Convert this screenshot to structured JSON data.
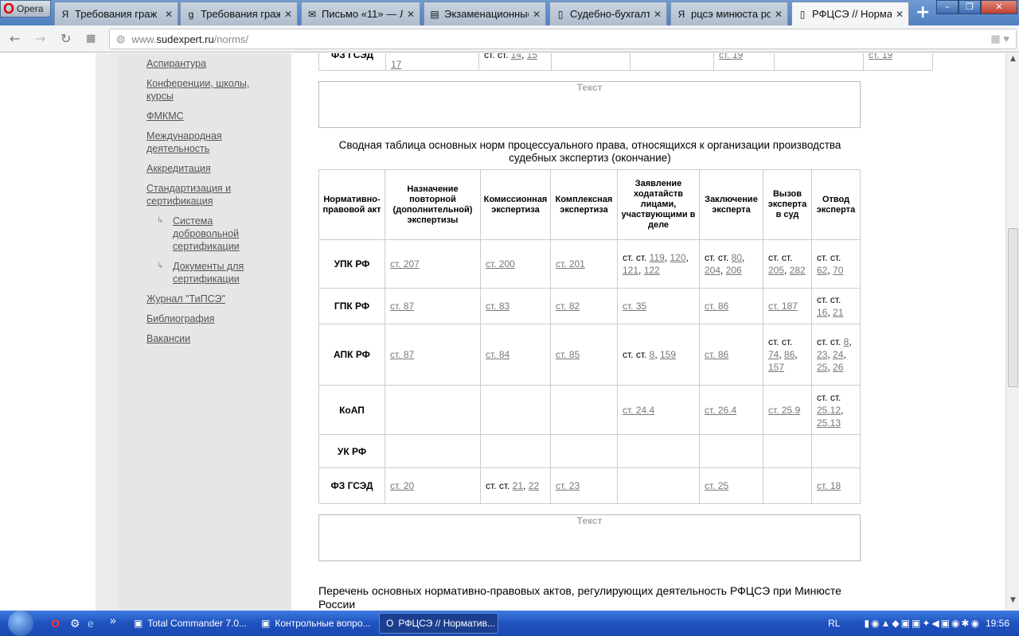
{
  "browser": {
    "menu_label": "Opera",
    "tabs": [
      {
        "title": "Требования граж",
        "icon": "yandex-icon"
      },
      {
        "title": "Требования граж",
        "icon": "google-icon"
      },
      {
        "title": "Письмо «11» — Л",
        "icon": "mail-icon"
      },
      {
        "title": "Экзаменационные",
        "icon": "document-icon"
      },
      {
        "title": "Судебно-бухгалте",
        "icon": "page-icon"
      },
      {
        "title": "рцсэ минюста рос",
        "icon": "yandex-icon"
      },
      {
        "title": "РФЦСЭ // Нормат",
        "icon": "page-icon",
        "active": true
      }
    ],
    "address_prefix": "www.",
    "address_domain": "sudexpert.ru",
    "address_path": "/norms/"
  },
  "sidebar": {
    "items": [
      {
        "label": "Аспирантура"
      },
      {
        "label": "Конференции, школы, курсы"
      },
      {
        "label": "ФМКМС"
      },
      {
        "label": "Международная деятельность"
      },
      {
        "label": "Аккредитация"
      },
      {
        "label": "Стандартизация и сертификация"
      },
      {
        "label": "Система добровольной сертификации",
        "sub": true
      },
      {
        "label": "Документы для сертификации",
        "sub": true
      },
      {
        "label": "Журнал \"ТиПСЭ\""
      },
      {
        "label": "Библиография"
      },
      {
        "label": "Вакансии"
      }
    ]
  },
  "top_row": {
    "act": "ФЗ ГСЭД",
    "c1": "17",
    "c2_prefix": "ст. ст. ",
    "c2_links": [
      "14",
      "15"
    ],
    "c5": "ст. 19",
    "c7": "ст. 19"
  },
  "text_placeholder": "Текст",
  "table": {
    "caption": "Сводная таблица основных норм процессуального права, относящихся к организации производства судебных экспертиз (окончание)",
    "headers": [
      "Нормативно-правовой акт",
      "Назначение повторной (дополнительной) экспертизы",
      "Комиссионная экспертиза",
      "Комплексная экспертиза",
      "Заявление ходатайств лицами, участвующими в деле",
      "Заключение эксперта",
      "Вызов эксперта в суд",
      "Отвод эксперта"
    ],
    "rows": [
      {
        "act": "УПК РФ",
        "cells": [
          {
            "links": [
              "ст. 207"
            ]
          },
          {
            "links": [
              "ст. 200"
            ]
          },
          {
            "links": [
              "ст. 201"
            ]
          },
          {
            "prefix": "ст. ст. ",
            "links": [
              "119",
              "120",
              "121",
              "122"
            ]
          },
          {
            "prefix": "ст. ст. ",
            "links": [
              "80",
              "204",
              "206"
            ]
          },
          {
            "prefix": "ст. ст. ",
            "links": [
              "205",
              "282"
            ]
          },
          {
            "prefix": "ст. ст. ",
            "links": [
              "62",
              "70"
            ]
          }
        ]
      },
      {
        "act": "ГПК РФ",
        "cells": [
          {
            "links": [
              "ст. 87"
            ]
          },
          {
            "links": [
              "ст. 83"
            ]
          },
          {
            "links": [
              "ст. 82"
            ]
          },
          {
            "links": [
              "ст. 35"
            ]
          },
          {
            "links": [
              "ст. 86"
            ]
          },
          {
            "links": [
              "ст. 187"
            ]
          },
          {
            "prefix": "ст. ст. ",
            "links": [
              "16",
              "21"
            ]
          }
        ]
      },
      {
        "act": "АПК РФ",
        "cells": [
          {
            "links": [
              "ст. 87"
            ]
          },
          {
            "links": [
              "ст. 84"
            ]
          },
          {
            "links": [
              "ст. 85"
            ]
          },
          {
            "prefix": "ст. ст. ",
            "links": [
              "8",
              "159"
            ]
          },
          {
            "links": [
              "ст. 86"
            ]
          },
          {
            "prefix": "ст. ст. ",
            "links": [
              "74",
              "86",
              "157"
            ]
          },
          {
            "prefix": "ст. ст. ",
            "links": [
              "8",
              "23",
              "24",
              "25",
              "26"
            ]
          }
        ]
      },
      {
        "act": "КоАП",
        "cells": [
          {},
          {},
          {},
          {
            "links": [
              "ст. 24.4"
            ]
          },
          {
            "links": [
              "ст. 26.4"
            ]
          },
          {
            "links": [
              "ст. 25.9"
            ]
          },
          {
            "prefix": "ст. ст. ",
            "links": [
              "25.12",
              "25.13"
            ]
          }
        ]
      },
      {
        "act": "УК РФ",
        "cells": [
          {},
          {},
          {},
          {},
          {},
          {},
          {}
        ]
      },
      {
        "act": "ФЗ ГСЭД",
        "cells": [
          {
            "links": [
              "ст. 20"
            ]
          },
          {
            "prefix": "ст. ст. ",
            "links": [
              "21",
              "22"
            ]
          },
          {
            "links": [
              "ст. 23"
            ]
          },
          {},
          {
            "links": [
              "ст. 25"
            ]
          },
          {},
          {
            "links": [
              "ст. 18"
            ]
          }
        ]
      }
    ]
  },
  "next_section_title": "Перечень основных нормативно-правовых актов, регулирующих деятельность РФЦСЭ при Минюсте России",
  "taskbar": {
    "tasks": [
      {
        "label": "Total Commander 7.0..."
      },
      {
        "label": "Контрольные вопро..."
      },
      {
        "label": "РФЦСЭ // Норматив...",
        "active": true
      }
    ],
    "lang": "RL",
    "clock": "19:56"
  }
}
